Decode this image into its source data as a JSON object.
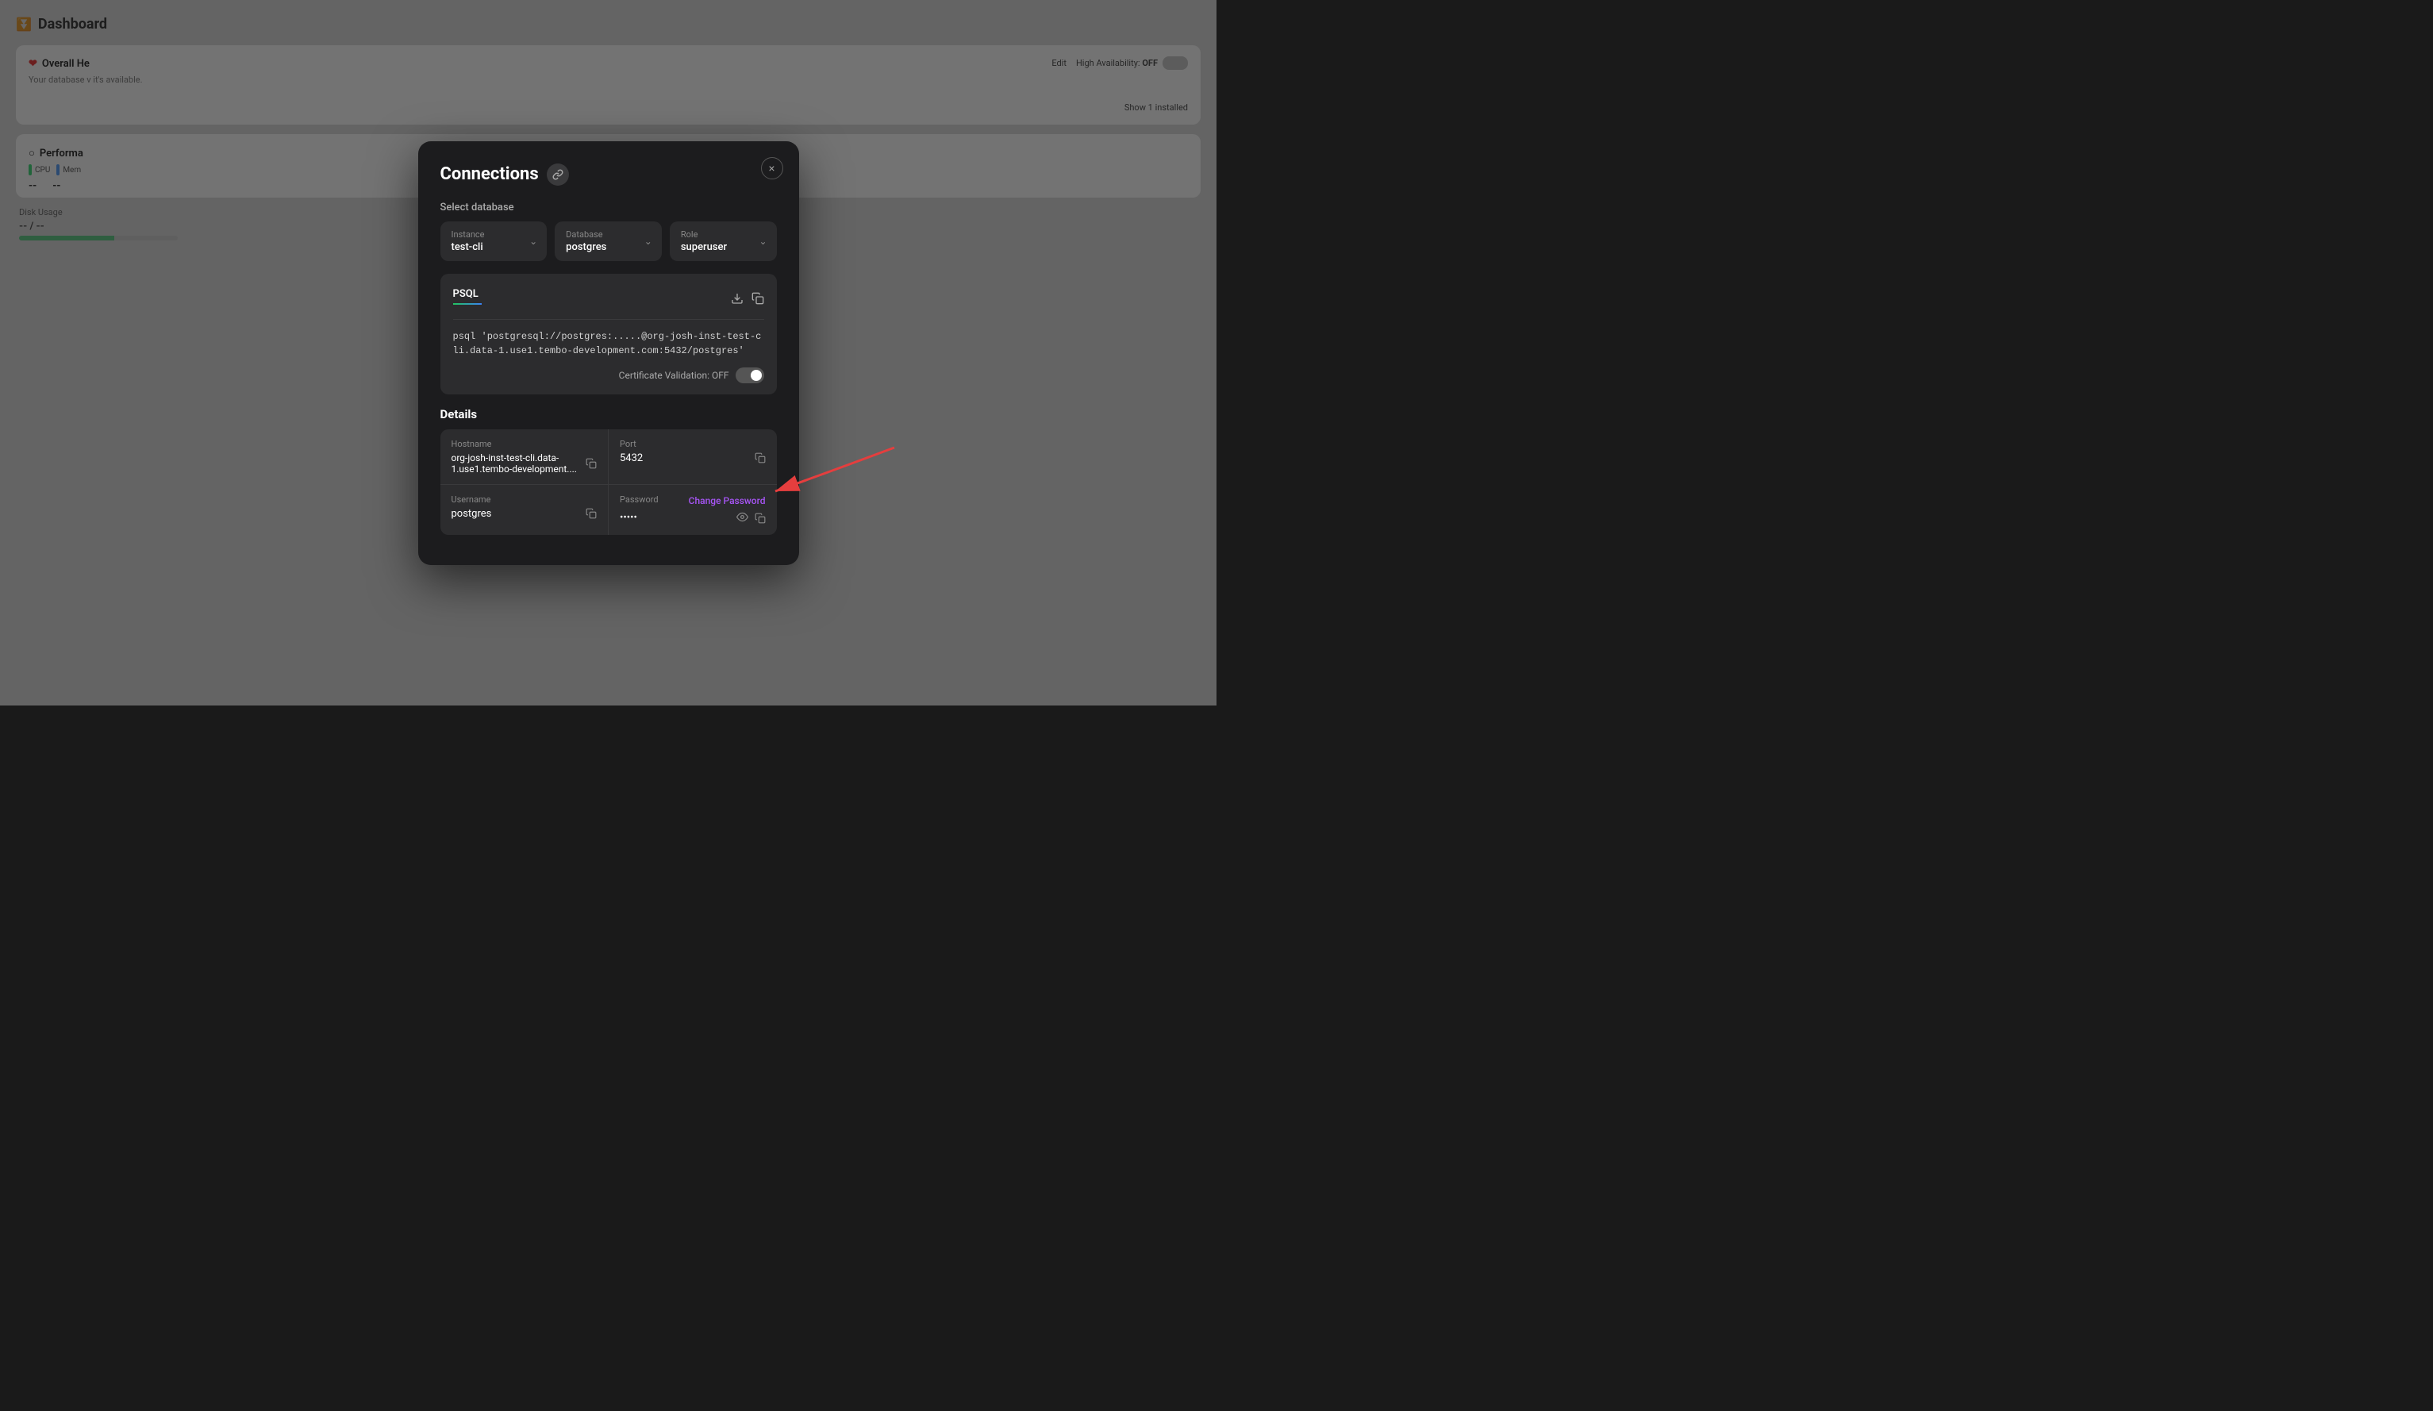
{
  "dashboard": {
    "title": "Dashboard",
    "overall_health": {
      "title": "Overall He",
      "text": "Your database v it's available.",
      "high_availability": "High Availability:",
      "high_availability_state": "OFF",
      "edit_label": "Edit"
    },
    "performance": {
      "title": "Performa",
      "cpu_label": "CPU",
      "mem_label": "Mem",
      "cpu_value": "--",
      "mem_value": "--"
    },
    "show_installed": "Show 1 installed",
    "disk_usage_label": "Disk Usage",
    "disk_usage_value": "-- / --"
  },
  "modal": {
    "title": "Connections",
    "close_label": "×",
    "select_database_label": "Select database",
    "instance": {
      "label": "Instance",
      "value": "test-cli"
    },
    "database": {
      "label": "Database",
      "value": "postgres"
    },
    "role": {
      "label": "Role",
      "value": "superuser"
    },
    "psql": {
      "tab_label": "PSQL",
      "command": "psql 'postgresql://postgres:.....@org-josh-inst-test-cli.data-1.use1.tembo-development.com:5432/postgres'",
      "cert_validation_label": "Certificate Validation: OFF"
    },
    "details": {
      "label": "Details",
      "hostname": {
        "label": "Hostname",
        "value": "org-josh-inst-test-cli.data-1.use1.tembo-development...."
      },
      "port": {
        "label": "Port",
        "value": "5432"
      },
      "username": {
        "label": "Username",
        "value": "postgres"
      },
      "password": {
        "label": "Password",
        "value": "•••••",
        "change_password_label": "Change Password"
      }
    }
  }
}
